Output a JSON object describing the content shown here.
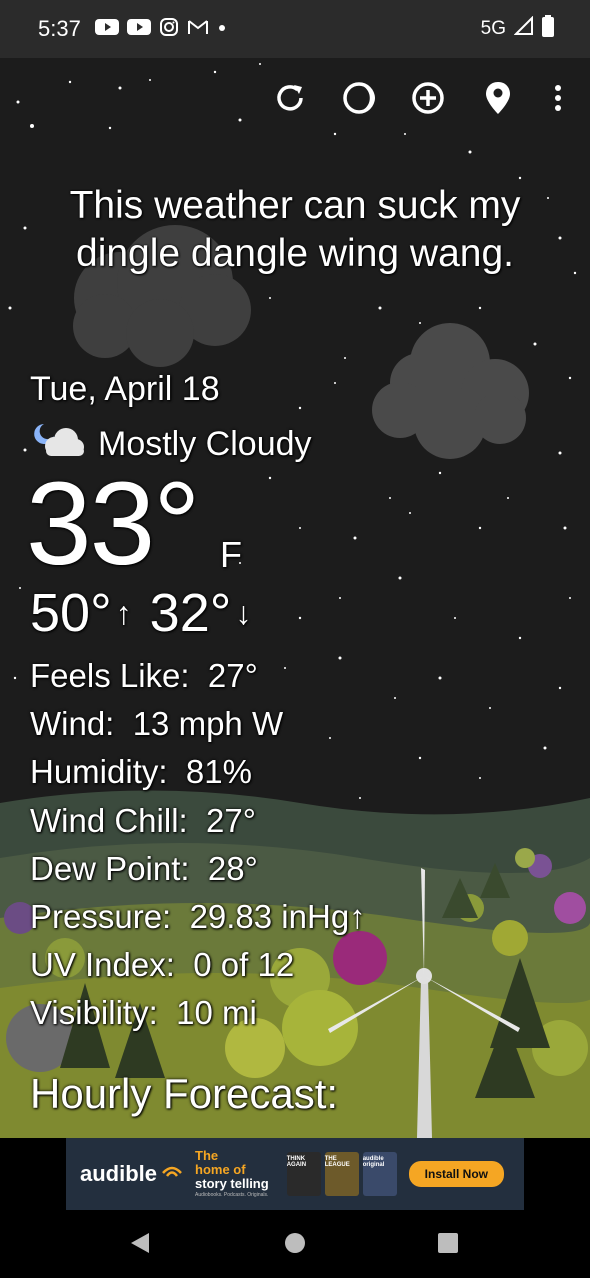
{
  "status_bar": {
    "time": "5:37",
    "network": "5G",
    "notification_icons": [
      "youtube-icon",
      "youtube-icon",
      "instagram-icon",
      "gmail-icon",
      "dot-icon"
    ]
  },
  "toolbar": {
    "icons": [
      "refresh-icon",
      "theme-icon",
      "add-location-icon",
      "location-pin-icon",
      "more-vert-icon"
    ]
  },
  "headline": "This weather can suck my dingle dangle wing wang.",
  "current": {
    "date": "Tue, April 18",
    "condition": "Mostly Cloudy",
    "condition_icon": "night-cloudy-icon",
    "temperature": "33°",
    "unit": "F",
    "high": "50°",
    "low": "32°"
  },
  "details": [
    {
      "label": "Feels Like:",
      "value": "27°"
    },
    {
      "label": "Wind:",
      "value": "13 mph W"
    },
    {
      "label": "Humidity:",
      "value": "81%"
    },
    {
      "label": "Wind Chill:",
      "value": "27°"
    },
    {
      "label": "Dew Point:",
      "value": "28°"
    },
    {
      "label": "Pressure:",
      "value": "29.83 inHg↑"
    },
    {
      "label": "UV Index:",
      "value": "0 of 12"
    },
    {
      "label": "Visibility:",
      "value": "10 mi"
    }
  ],
  "hourly_title": "Hourly Forecast:",
  "ad": {
    "brand": "audible",
    "tagline_1": "The",
    "tagline_2": "home of",
    "tagline_3": "story telling",
    "tagline_small": "Audiobooks. Podcasts. Originals.",
    "cover_1": "THINK AGAIN",
    "cover_2": "THE LEAGUE",
    "cover_3": "audible original",
    "button": "Install Now",
    "colors": {
      "background": "#232f3e",
      "accent": "#f5a623"
    }
  },
  "nav_bar": {
    "icons": [
      "back-icon",
      "home-icon",
      "recents-icon"
    ]
  }
}
